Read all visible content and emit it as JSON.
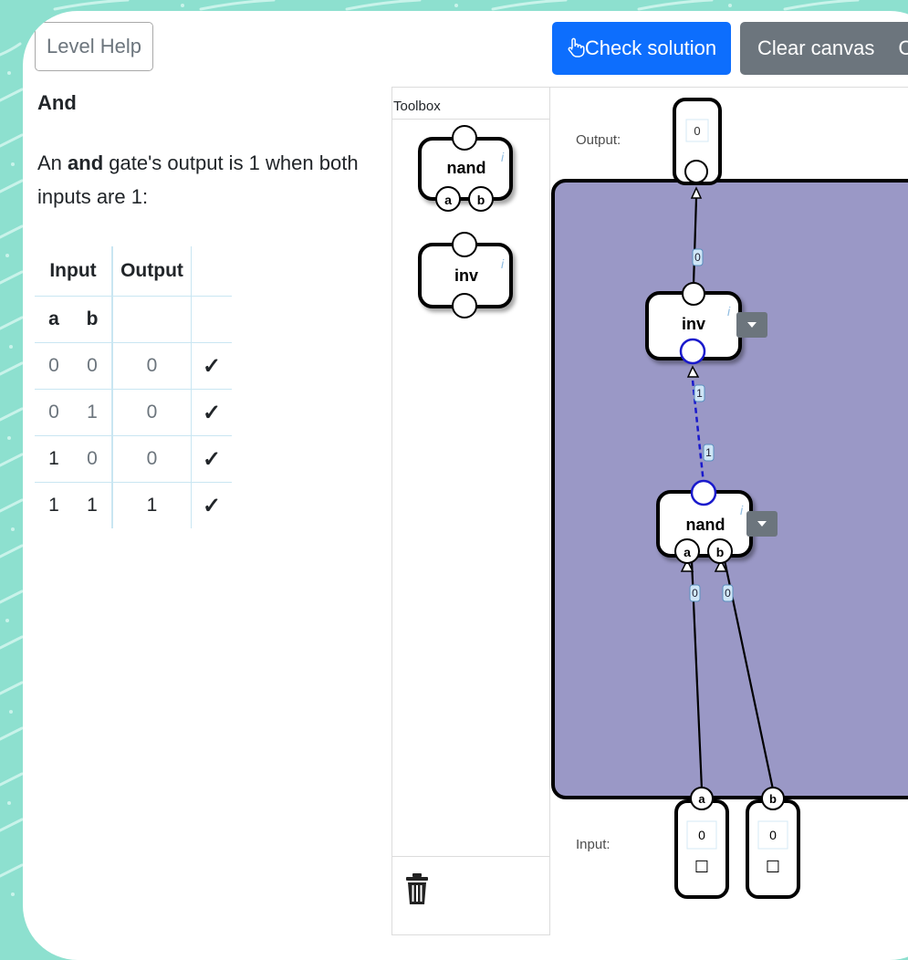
{
  "header": {
    "help_label": "Level Help",
    "check_label": "Check solution",
    "check_icon": "hand-pointer-icon",
    "clear_label": "Clear canvas",
    "extra_label": "C"
  },
  "level": {
    "title": "And",
    "description": {
      "prefix": "An ",
      "bold": "and",
      "suffix": " gate's output is 1 when both inputs are 1:"
    }
  },
  "truth_table": {
    "input_header": "Input",
    "output_header": "Output",
    "col_a": "a",
    "col_b": "b",
    "rows": [
      {
        "a": "0",
        "b": "0",
        "out": "0",
        "check": "✓"
      },
      {
        "a": "0",
        "b": "1",
        "out": "0",
        "check": "✓"
      },
      {
        "a": "1",
        "b": "0",
        "out": "0",
        "check": "✓"
      },
      {
        "a": "1",
        "b": "1",
        "out": "1",
        "check": "✓"
      }
    ]
  },
  "toolbox": {
    "title": "Toolbox",
    "items": [
      {
        "name": "nand",
        "ports": [
          "a",
          "b"
        ],
        "info": "i"
      },
      {
        "name": "inv",
        "info": "i"
      }
    ],
    "trash_icon": "trash-icon"
  },
  "canvas": {
    "output_label": "Output:",
    "input_label": "Input:",
    "output_value": "0",
    "inputs": [
      {
        "name": "a",
        "value": "0",
        "checkbox": "☐"
      },
      {
        "name": "b",
        "value": "0",
        "checkbox": "☐"
      }
    ],
    "gates": [
      {
        "name": "inv",
        "info": "i"
      },
      {
        "name": "nand",
        "ports": [
          "a",
          "b"
        ],
        "info": "i"
      }
    ],
    "wire_values": {
      "inv_to_output": "0",
      "nand_to_inv_top": "1",
      "nand_to_inv_bottom": "1",
      "a_to_nand": "0",
      "b_to_nand": "0"
    }
  },
  "colors": {
    "background": "#8de0cf",
    "primary": "#0d6efd",
    "secondary": "#6c757d",
    "circuit_area": "#9a98c6",
    "active_wire": "#1a1acc"
  }
}
